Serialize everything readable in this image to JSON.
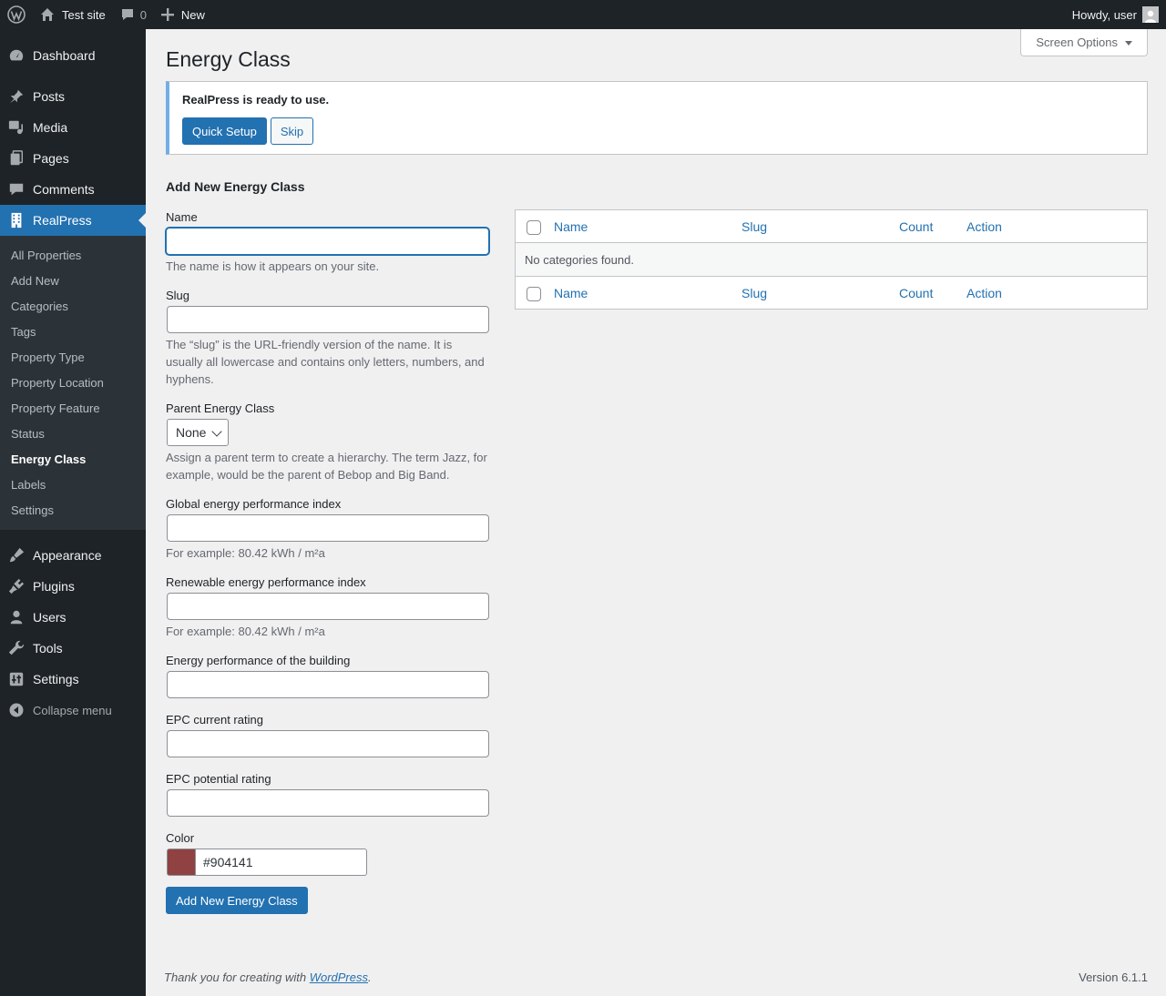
{
  "adminbar": {
    "site_name": "Test site",
    "comments_count": "0",
    "new_label": "New",
    "howdy": "Howdy, user"
  },
  "sidebar": {
    "top_items": [
      {
        "label": "Dashboard",
        "icon": "dashboard-icon"
      },
      {
        "label": "Posts",
        "icon": "pin-icon"
      },
      {
        "label": "Media",
        "icon": "media-icon"
      },
      {
        "label": "Pages",
        "icon": "pages-icon"
      },
      {
        "label": "Comments",
        "icon": "comment-icon"
      },
      {
        "label": "RealPress",
        "icon": "building-icon"
      }
    ],
    "submenu": [
      "All Properties",
      "Add New",
      "Categories",
      "Tags",
      "Property Type",
      "Property Location",
      "Property Feature",
      "Status",
      "Energy Class",
      "Labels",
      "Settings"
    ],
    "bottom_items": [
      {
        "label": "Appearance",
        "icon": "brush-icon"
      },
      {
        "label": "Plugins",
        "icon": "plugin-icon"
      },
      {
        "label": "Users",
        "icon": "user-icon"
      },
      {
        "label": "Tools",
        "icon": "wrench-icon"
      },
      {
        "label": "Settings",
        "icon": "settings-icon"
      }
    ],
    "collapse_label": "Collapse menu"
  },
  "screen_options": "Screen Options",
  "page_title": "Energy Class",
  "notice": {
    "message": "RealPress is ready to use.",
    "quick_setup": "Quick Setup",
    "skip": "Skip"
  },
  "form": {
    "heading": "Add New Energy Class",
    "name_label": "Name",
    "name_desc": "The name is how it appears on your site.",
    "slug_label": "Slug",
    "slug_desc": "The “slug” is the URL-friendly version of the name. It is usually all lowercase and contains only letters, numbers, and hyphens.",
    "parent_label": "Parent Energy Class",
    "parent_value": "None",
    "parent_desc": "Assign a parent term to create a hierarchy. The term Jazz, for example, would be the parent of Bebop and Big Band.",
    "global_label": "Global energy performance index",
    "global_desc": "For example: 80.42 kWh / m²a",
    "renewable_label": "Renewable energy performance index",
    "renewable_desc": "For example: 80.42 kWh / m²a",
    "building_label": "Energy performance of the building",
    "epc_current_label": "EPC current rating",
    "epc_potential_label": "EPC potential rating",
    "color_label": "Color",
    "color_value": "#904141",
    "submit": "Add New Energy Class"
  },
  "table": {
    "columns": [
      "Name",
      "Slug",
      "Count",
      "Action"
    ],
    "empty": "No categories found."
  },
  "footer": {
    "thanks_prefix": "Thank you for creating with ",
    "thanks_link": "WordPress",
    "thanks_suffix": ".",
    "version": "Version 6.1.1"
  }
}
